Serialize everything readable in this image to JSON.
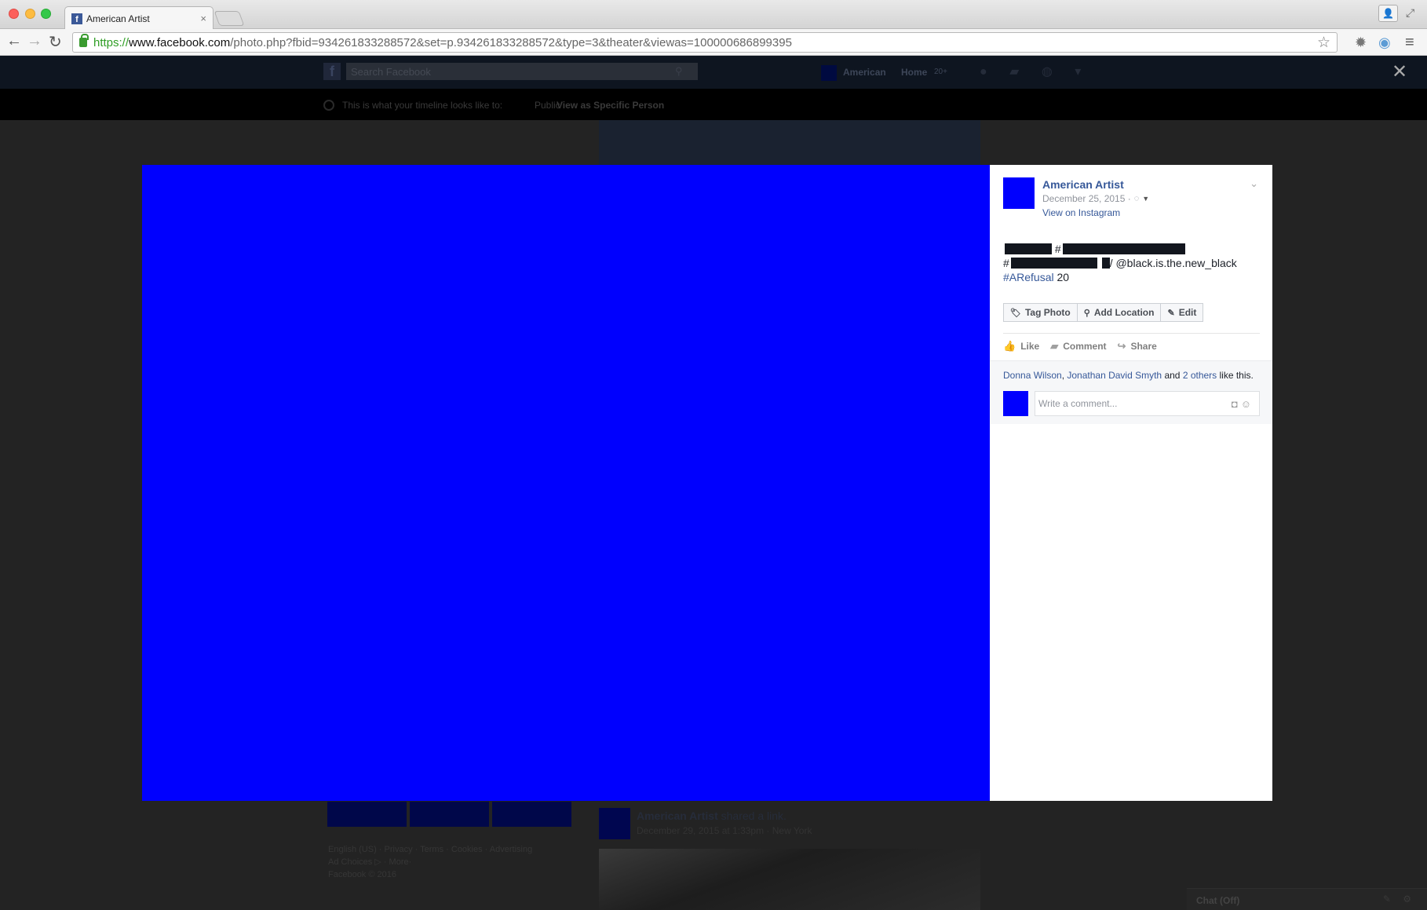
{
  "browser": {
    "tab_title": "American Artist",
    "tab_favicon": "f",
    "tab_close": "×",
    "url_scheme": "https://",
    "url_host": "www.facebook.com",
    "url_path": "/photo.php?fbid=934261833288572&set=p.934261833288572&type=3&theater&viewas=100000686899395"
  },
  "icons": {
    "profile": "👤",
    "expand": "⤢",
    "back": "←",
    "forward": "→",
    "reload": "↻",
    "star": "☆",
    "extension": "✹",
    "camera": "◉",
    "menu": "≡",
    "close": "✕",
    "search": "⚲",
    "globe": "◌",
    "caret_down": "▼",
    "chevron_down": "⌄",
    "tag": "🏷",
    "pin": "⚲",
    "pencil": "✎",
    "thumb": "👍",
    "speech": "▰",
    "share_arrow": "↪",
    "photo_camera": "◘",
    "smiley": "☺"
  },
  "background_page": {
    "search_placeholder": "Search Facebook",
    "nav_name": "American",
    "nav_home": "Home",
    "nav_count": "20+",
    "viewbar_text": "This is what your timeline looks like to:",
    "viewbar_public": "Public",
    "viewbar_specific": "View as Specific Person",
    "footer_line1": "English (US) · Privacy · Terms · Cookies · Advertising",
    "footer_line2": "Ad Choices ▷ · More·",
    "footer_line3": "Facebook © 2016",
    "post_author": "American Artist",
    "post_action": "shared a link.",
    "post_date": "December 29, 2015 at 1:33pm · New York",
    "chat_label": "Chat (Off)"
  },
  "theater": {
    "photo_color": "#0000fe",
    "author_name": "American Artist",
    "post_date": "December 25, 2015 ·",
    "view_on_instagram": "View on Instagram",
    "caption": {
      "line1_hash": "#",
      "line2_hash": "#",
      "line2_slash": "/",
      "mention": " @black.is.the.new_black",
      "hashtag": "#ARefusal",
      "number": " 20"
    },
    "buttons": {
      "tag_photo": "Tag Photo",
      "add_location": "Add Location",
      "edit": "Edit"
    },
    "ufi": {
      "like": "Like",
      "comment": "Comment",
      "share": "Share"
    },
    "likes": {
      "name1": "Donna Wilson",
      "sep": ", ",
      "name2": "Jonathan David Smyth",
      "and": " and ",
      "others": "2 others",
      "suffix": " like this."
    },
    "comment_placeholder": "Write a comment..."
  }
}
